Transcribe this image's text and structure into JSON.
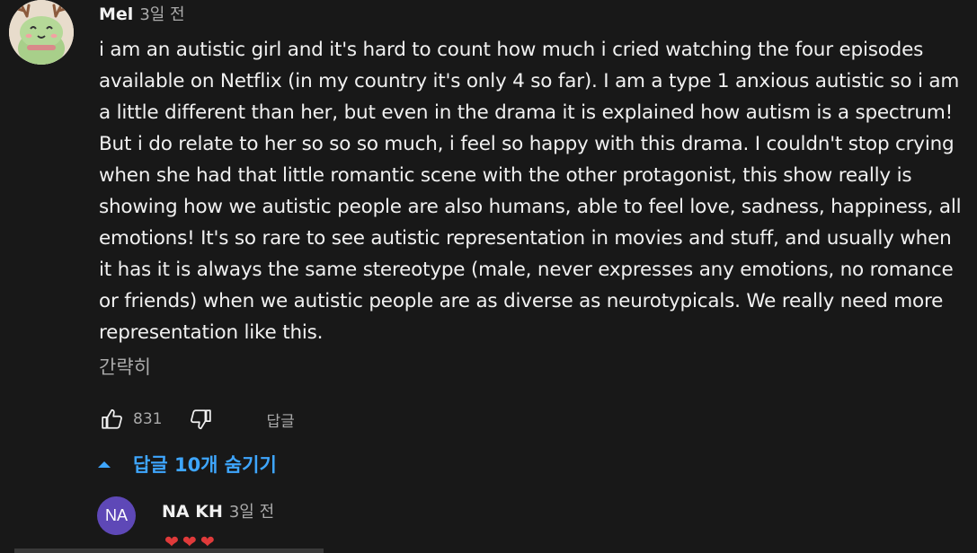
{
  "comment": {
    "avatar_icon": "deer-frog-cartoon-avatar-icon",
    "author": "Mel",
    "time": "3일 전",
    "text": "i am an autistic girl and it's hard to count how much i cried watching the four episodes available on Netflix (in my country it's only 4 so far). I am a type 1 anxious autistic so i am a little different than her, but even in the drama it is explained how autism is a spectrum! But i do relate to her so so so much, i feel so happy with this drama. I couldn't stop crying when she had that little romantic scene with the other protagonist, this show really is showing how we autistic people are also humans, able to feel love, sadness, happiness, all emotions! It's so rare to see autistic representation in movies and stuff, and usually when it has it is always the same stereotype (male, never expresses any emotions, no romance or friends) when we autistic people are as diverse as neurotypicals. We really need more representation like this.",
    "read_less": "간략히",
    "like_count": "831",
    "reply_label": "답글"
  },
  "replies_toggle": {
    "label": "답글 10개 숨기기"
  },
  "reply": {
    "avatar_initials": "NA",
    "author": "NA KH",
    "time": "3일 전",
    "text": "❤❤❤"
  },
  "colors": {
    "background": "#181818",
    "text_primary": "#f1f1f1",
    "text_secondary": "#aaaaaa",
    "link_blue": "#3ea6ff",
    "reply_avatar": "#5e48b7",
    "heart_red": "#e03a3a"
  }
}
